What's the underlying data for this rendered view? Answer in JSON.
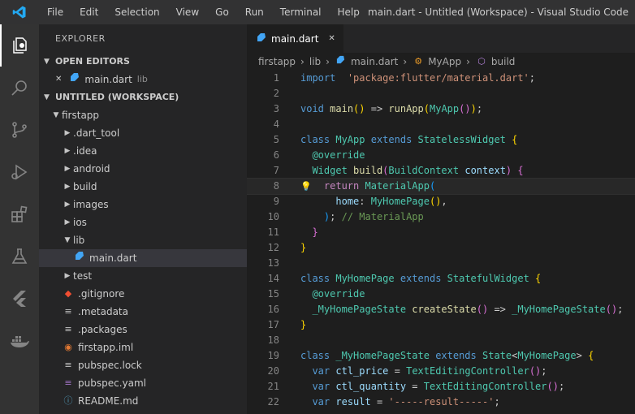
{
  "titlebar": {
    "menu": [
      "File",
      "Edit",
      "Selection",
      "View",
      "Go",
      "Run",
      "Terminal",
      "Help"
    ],
    "window_title": "main.dart - Untitled (Workspace) - Visual Studio Code"
  },
  "activitybar": {
    "icons": [
      "explorer-icon",
      "search-icon",
      "source-control-icon",
      "run-debug-icon",
      "extensions-icon",
      "testing-icon",
      "flutter-icon",
      "docker-icon"
    ]
  },
  "sidebar": {
    "title": "EXPLORER",
    "open_editors_label": "OPEN EDITORS",
    "open_editor_file": "main.dart",
    "open_editor_path": "lib",
    "workspace_label": "UNTITLED (WORKSPACE)",
    "tree": [
      {
        "label": "firstapp",
        "kind": "folder-open",
        "depth": 1
      },
      {
        "label": ".dart_tool",
        "kind": "folder",
        "depth": 2
      },
      {
        "label": ".idea",
        "kind": "folder",
        "depth": 2
      },
      {
        "label": "android",
        "kind": "folder",
        "depth": 2
      },
      {
        "label": "build",
        "kind": "folder",
        "depth": 2
      },
      {
        "label": "images",
        "kind": "folder",
        "depth": 2
      },
      {
        "label": "ios",
        "kind": "folder",
        "depth": 2
      },
      {
        "label": "lib",
        "kind": "folder-open",
        "depth": 2
      },
      {
        "label": "main.dart",
        "kind": "dart",
        "depth": 3,
        "selected": true
      },
      {
        "label": "test",
        "kind": "folder",
        "depth": 2
      },
      {
        "label": ".gitignore",
        "kind": "git",
        "depth": 2
      },
      {
        "label": ".metadata",
        "kind": "file",
        "depth": 2
      },
      {
        "label": ".packages",
        "kind": "file",
        "depth": 2
      },
      {
        "label": "firstapp.iml",
        "kind": "xml",
        "depth": 2
      },
      {
        "label": "pubspec.lock",
        "kind": "file",
        "depth": 2
      },
      {
        "label": "pubspec.yaml",
        "kind": "yaml",
        "depth": 2
      },
      {
        "label": "README.md",
        "kind": "info",
        "depth": 2
      }
    ]
  },
  "editor": {
    "tab_label": "main.dart",
    "breadcrumb": [
      "firstapp",
      "lib",
      "main.dart",
      "MyApp",
      "build"
    ],
    "lines": [
      {
        "n": "1",
        "tokens": [
          [
            "kw",
            "import"
          ],
          [
            "",
            "  "
          ],
          [
            "str",
            "'package:flutter/material.dart'"
          ],
          [
            "",
            ";"
          ]
        ]
      },
      {
        "n": "2",
        "tokens": []
      },
      {
        "n": "3",
        "tokens": [
          [
            "kw",
            "void"
          ],
          [
            "",
            " "
          ],
          [
            "fn",
            "main"
          ],
          [
            "p1",
            "()"
          ],
          [
            "",
            " => "
          ],
          [
            "fn",
            "runApp"
          ],
          [
            "p1",
            "("
          ],
          [
            "cls",
            "MyApp"
          ],
          [
            "p2",
            "()"
          ],
          [
            "p1",
            ")"
          ],
          [
            "",
            ";"
          ]
        ]
      },
      {
        "n": "4",
        "tokens": []
      },
      {
        "n": "5",
        "tokens": [
          [
            "kw",
            "class"
          ],
          [
            "",
            " "
          ],
          [
            "cls",
            "MyApp"
          ],
          [
            "",
            " "
          ],
          [
            "kw",
            "extends"
          ],
          [
            "",
            " "
          ],
          [
            "cls",
            "StatelessWidget"
          ],
          [
            "",
            " "
          ],
          [
            "p1",
            "{"
          ]
        ]
      },
      {
        "n": "6",
        "tokens": [
          [
            "",
            "  "
          ],
          [
            "ann",
            "@override"
          ]
        ]
      },
      {
        "n": "7",
        "tokens": [
          [
            "",
            "  "
          ],
          [
            "cls",
            "Widget"
          ],
          [
            "",
            " "
          ],
          [
            "fn",
            "build"
          ],
          [
            "p2",
            "("
          ],
          [
            "cls",
            "BuildContext"
          ],
          [
            "",
            " "
          ],
          [
            "var",
            "context"
          ],
          [
            "p2",
            ")"
          ],
          [
            "",
            " "
          ],
          [
            "p2",
            "{"
          ]
        ]
      },
      {
        "n": "8",
        "current": true,
        "tokens": [
          [
            "",
            "    "
          ],
          [
            "ctl",
            "return"
          ],
          [
            "",
            " "
          ],
          [
            "cls",
            "MaterialApp"
          ],
          [
            "p3",
            "("
          ]
        ]
      },
      {
        "n": "9",
        "tokens": [
          [
            "",
            "      "
          ],
          [
            "var",
            "home"
          ],
          [
            "",
            ": "
          ],
          [
            "cls",
            "MyHomePage"
          ],
          [
            "p1",
            "()"
          ],
          [
            "",
            ","
          ]
        ]
      },
      {
        "n": "10",
        "tokens": [
          [
            "",
            "    "
          ],
          [
            "p3",
            ")"
          ],
          [
            "",
            ";"
          ],
          [
            "cmt",
            " // MaterialApp"
          ]
        ]
      },
      {
        "n": "11",
        "tokens": [
          [
            "",
            "  "
          ],
          [
            "p2",
            "}"
          ]
        ]
      },
      {
        "n": "12",
        "tokens": [
          [
            "p1",
            "}"
          ]
        ]
      },
      {
        "n": "13",
        "tokens": []
      },
      {
        "n": "14",
        "tokens": [
          [
            "kw",
            "class"
          ],
          [
            "",
            " "
          ],
          [
            "cls",
            "MyHomePage"
          ],
          [
            "",
            " "
          ],
          [
            "kw",
            "extends"
          ],
          [
            "",
            " "
          ],
          [
            "cls",
            "StatefulWidget"
          ],
          [
            "",
            " "
          ],
          [
            "p1",
            "{"
          ]
        ]
      },
      {
        "n": "15",
        "tokens": [
          [
            "",
            "  "
          ],
          [
            "ann",
            "@override"
          ]
        ]
      },
      {
        "n": "16",
        "tokens": [
          [
            "",
            "  "
          ],
          [
            "cls",
            "_MyHomePageState"
          ],
          [
            "",
            " "
          ],
          [
            "fn",
            "createState"
          ],
          [
            "p2",
            "()"
          ],
          [
            "",
            " => "
          ],
          [
            "cls",
            "_MyHomePageState"
          ],
          [
            "p2",
            "()"
          ],
          [
            "",
            ";"
          ]
        ]
      },
      {
        "n": "17",
        "tokens": [
          [
            "p1",
            "}"
          ]
        ]
      },
      {
        "n": "18",
        "tokens": []
      },
      {
        "n": "19",
        "tokens": [
          [
            "kw",
            "class"
          ],
          [
            "",
            " "
          ],
          [
            "cls",
            "_MyHomePageState"
          ],
          [
            "",
            " "
          ],
          [
            "kw",
            "extends"
          ],
          [
            "",
            " "
          ],
          [
            "cls",
            "State"
          ],
          [
            "",
            "<"
          ],
          [
            "cls",
            "MyHomePage"
          ],
          [
            "",
            "> "
          ],
          [
            "p1",
            "{"
          ]
        ]
      },
      {
        "n": "20",
        "tokens": [
          [
            "",
            "  "
          ],
          [
            "kw",
            "var"
          ],
          [
            "",
            " "
          ],
          [
            "var",
            "ctl_price"
          ],
          [
            "",
            " = "
          ],
          [
            "cls",
            "TextEditingController"
          ],
          [
            "p2",
            "()"
          ],
          [
            "",
            ";"
          ]
        ]
      },
      {
        "n": "21",
        "tokens": [
          [
            "",
            "  "
          ],
          [
            "kw",
            "var"
          ],
          [
            "",
            " "
          ],
          [
            "var",
            "ctl_quantity"
          ],
          [
            "",
            " = "
          ],
          [
            "cls",
            "TextEditingController"
          ],
          [
            "p2",
            "()"
          ],
          [
            "",
            ";"
          ]
        ]
      },
      {
        "n": "22",
        "tokens": [
          [
            "",
            "  "
          ],
          [
            "kw",
            "var"
          ],
          [
            "",
            " "
          ],
          [
            "var",
            "result"
          ],
          [
            "",
            " = "
          ],
          [
            "str",
            "'-----result-----'"
          ],
          [
            "",
            ";"
          ]
        ]
      }
    ]
  },
  "colors": {
    "titlebar_bg": "#323233",
    "activitybar_bg": "#333333",
    "sidebar_bg": "#252526",
    "editor_bg": "#1e1e1e",
    "vscode_blue": "#23a9f2",
    "dart_blue": "#42a5f5"
  }
}
